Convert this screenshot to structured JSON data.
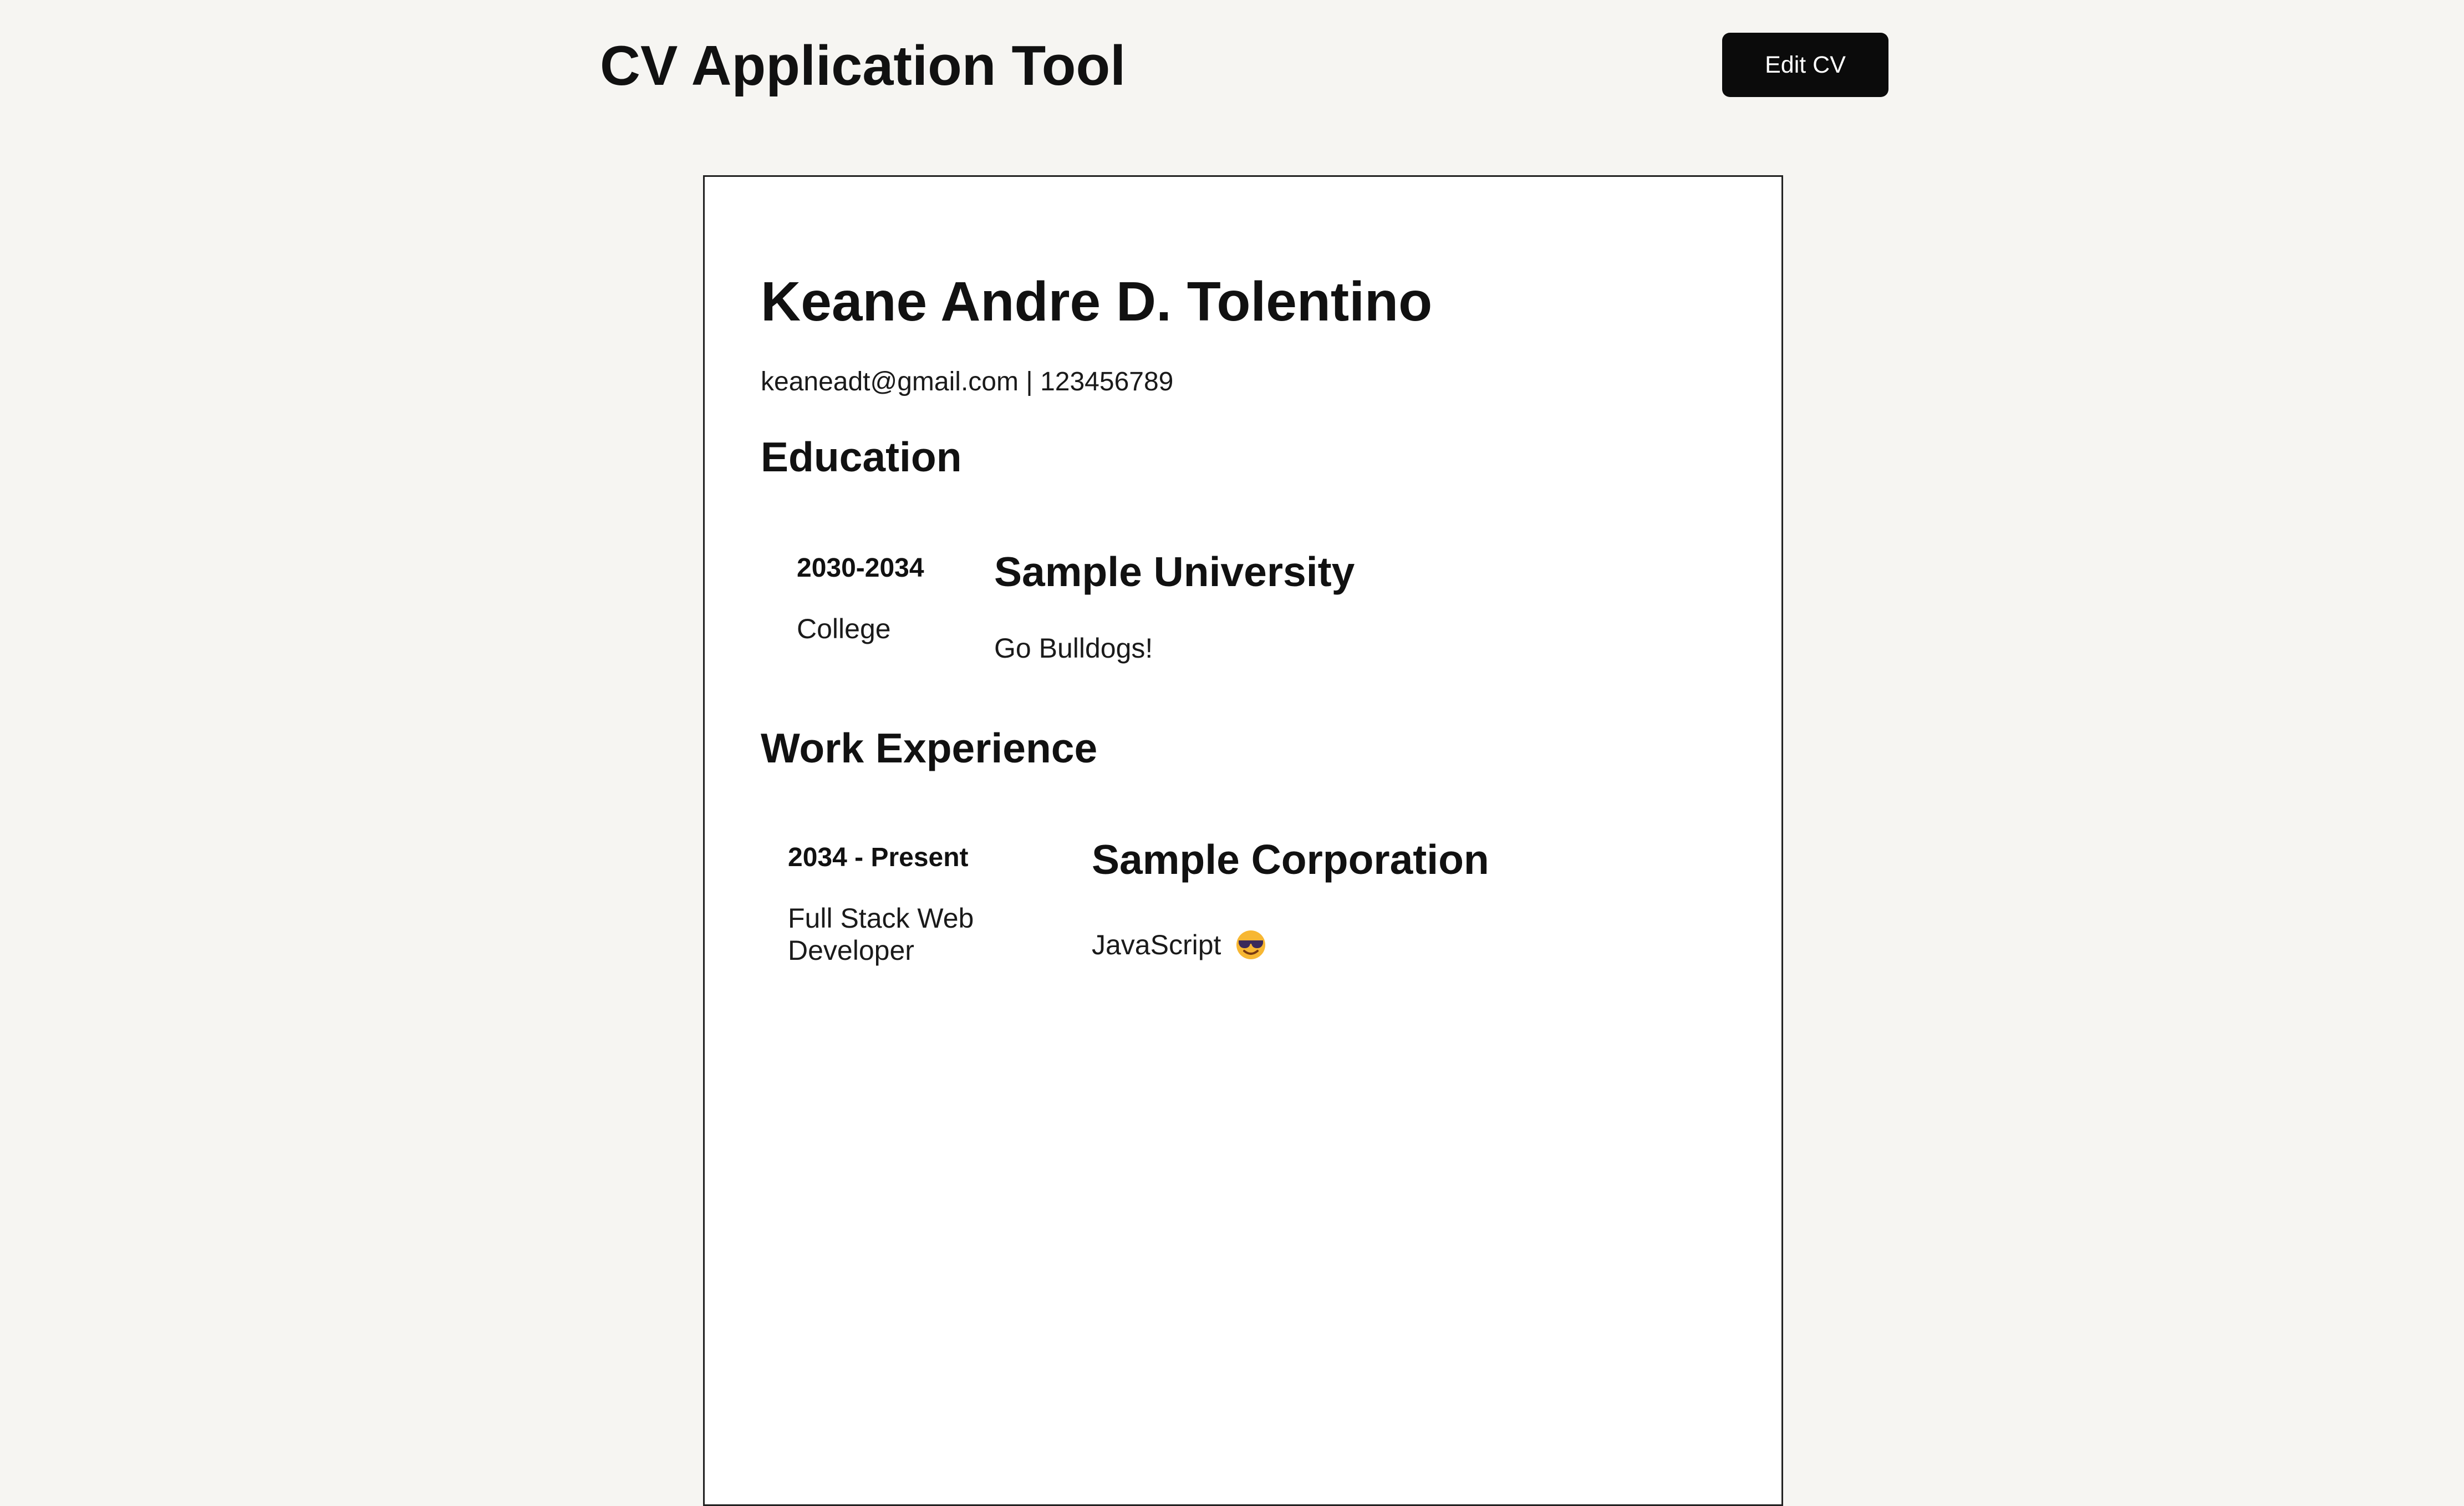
{
  "header": {
    "title": "CV Application Tool",
    "edit_button_label": "Edit CV"
  },
  "cv": {
    "name": "Keane Andre D. Tolentino",
    "contact": "keaneadt@gmail.com | 123456789",
    "education": {
      "section_title": "Education",
      "entries": [
        {
          "dates": "2030-2034",
          "level": "College",
          "school": "Sample University",
          "description": "Go Bulldogs!"
        }
      ]
    },
    "work": {
      "section_title": "Work Experience",
      "entries": [
        {
          "dates": "2034 - Present",
          "role": "Full Stack Web Developer",
          "company": "Sample Corporation",
          "description": "JavaScript",
          "description_icon": "smiling-face-with-sunglasses-icon"
        }
      ]
    }
  }
}
